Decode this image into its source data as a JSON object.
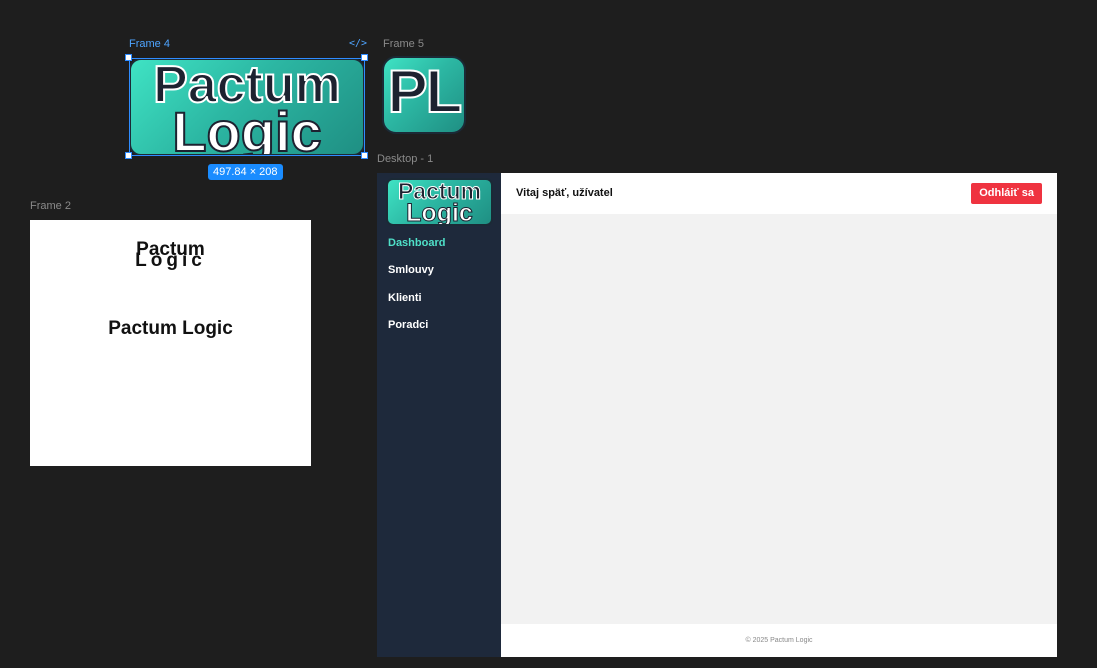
{
  "canvas": {
    "background": "#1e1e1e",
    "frames": {
      "frame4_label": "Frame 4",
      "frame5_label": "Frame 5",
      "frame2_label": "Frame 2",
      "desktop_label": "Desktop - 1"
    },
    "selection": {
      "size_badge": "497.84 × 208",
      "code_icon": "code-icon"
    }
  },
  "logo": {
    "line1": "Pactum",
    "line2": "Logic",
    "monogram": "PL",
    "gradient_start": "#3fe3c4",
    "gradient_end": "#1f8f83"
  },
  "frame2": {
    "stacked_top": "Pactum",
    "stacked_bottom": "Logic",
    "heading": "Pactum Logic"
  },
  "desktop": {
    "brand_line1": "Pactum",
    "brand_line2": "Logic",
    "nav": [
      {
        "label": "Dashboard",
        "active": true
      },
      {
        "label": "Smlouvy",
        "active": false
      },
      {
        "label": "Klienti",
        "active": false
      },
      {
        "label": "Poradci",
        "active": false
      }
    ],
    "welcome": "Vitaj späť, užívatel",
    "logout_label": "Odhláiť sa",
    "footer": "© 2025 Pactum Logic",
    "colors": {
      "sidebar": "#1e293b",
      "active_nav": "#4fe0c8",
      "logout": "#ef3340",
      "content_bg": "#f2f2f2"
    }
  }
}
